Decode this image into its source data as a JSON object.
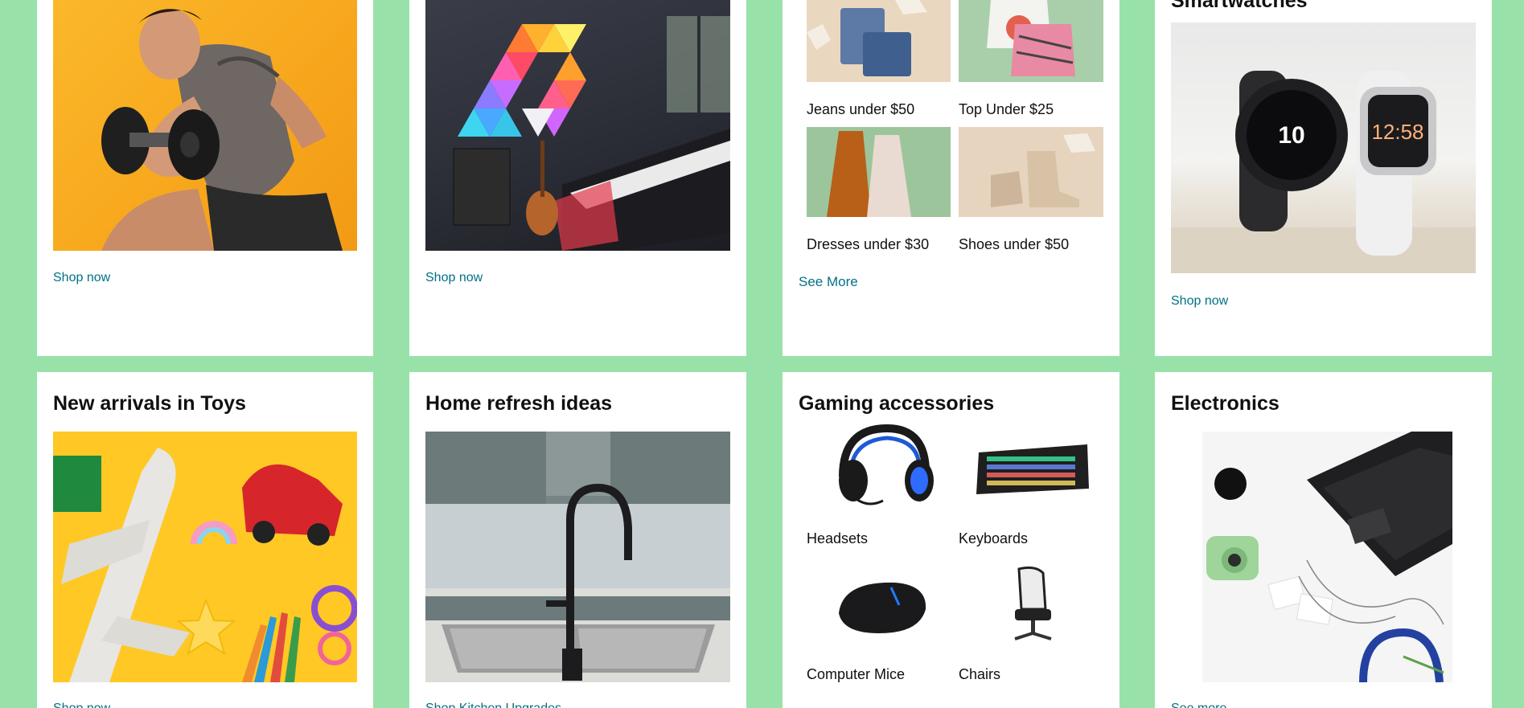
{
  "colors": {
    "page_bg": "#98e2aa",
    "card_bg": "#ffffff",
    "link": "#007185",
    "text": "#0f1111"
  },
  "row1": {
    "fitness": {
      "link": "Shop now"
    },
    "lighting": {
      "link": "Shop now"
    },
    "fashion": {
      "items": [
        {
          "label": "Jeans under $50"
        },
        {
          "label": "Top Under $25"
        },
        {
          "label": "Dresses under $30"
        },
        {
          "label": "Shoes under $50"
        }
      ],
      "link": "See More"
    },
    "smartwatches": {
      "title": "Smartwatches",
      "link": "Shop now",
      "watch_time_left": "10",
      "watch_time_right": "12:58"
    }
  },
  "row2": {
    "toys": {
      "title": "New arrivals in Toys",
      "link": "Shop now"
    },
    "home": {
      "title": "Home refresh ideas",
      "link": "Shop Kitchen Upgrades"
    },
    "gaming": {
      "title": "Gaming accessories",
      "items": [
        {
          "label": "Headsets",
          "icon": "headset-icon"
        },
        {
          "label": "Keyboards",
          "icon": "keyboard-icon"
        },
        {
          "label": "Computer Mice",
          "icon": "mouse-icon"
        },
        {
          "label": "Chairs",
          "icon": "chair-icon"
        }
      ]
    },
    "electronics": {
      "title": "Electronics",
      "link": "See more"
    }
  }
}
